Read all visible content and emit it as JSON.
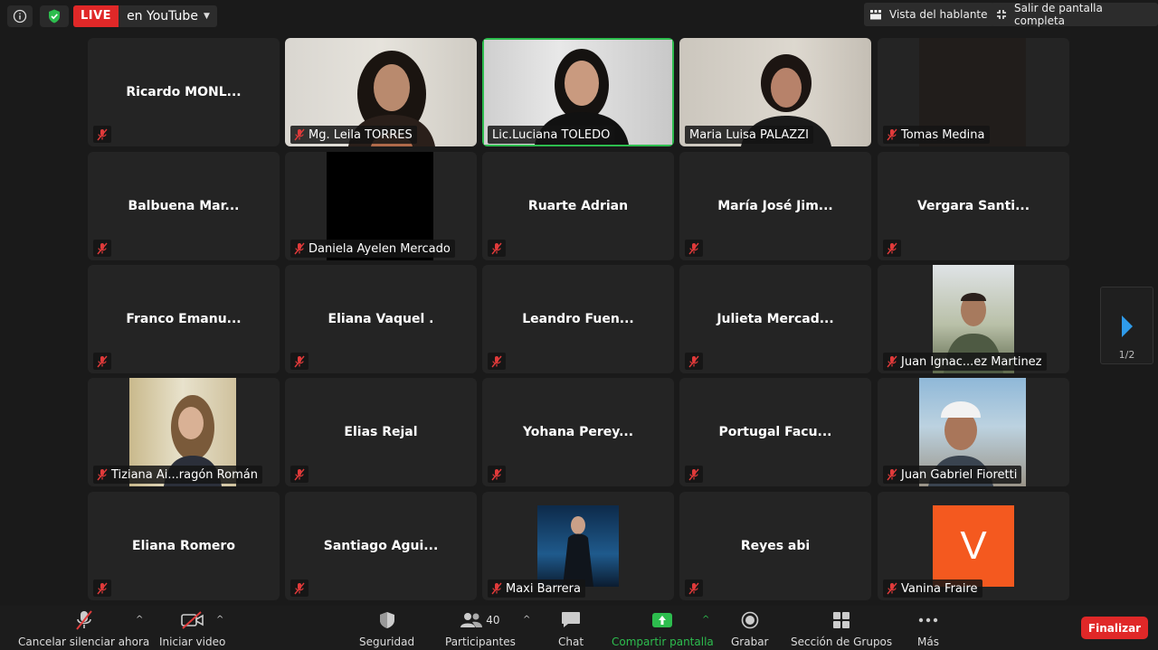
{
  "topbar": {
    "live_badge": "LIVE",
    "live_target": "en YouTube",
    "speaker_view": "Vista del hablante",
    "exit_fullscreen": "Salir de pantalla completa"
  },
  "participants": [
    {
      "name": "Ricardo MONL...",
      "video": false
    },
    {
      "name": "Mg. Leila TORRES",
      "video": true
    },
    {
      "name": "Lic.Luciana TOLEDO",
      "video": true,
      "active_speaker": true
    },
    {
      "name": "Maria Luisa PALAZZI",
      "video": true
    },
    {
      "name": "Tomas Medina",
      "video": true
    },
    {
      "name": "Balbuena Mar...",
      "video": false
    },
    {
      "name": "Daniela Ayelen Mercado",
      "video": true
    },
    {
      "name": "Ruarte Adrian",
      "video": false
    },
    {
      "name": "María José Jim...",
      "video": false
    },
    {
      "name": "Vergara Santi...",
      "video": false
    },
    {
      "name": "Franco Emanu...",
      "video": false
    },
    {
      "name": "Eliana Vaquel .",
      "video": false
    },
    {
      "name": "Leandro Fuen...",
      "video": false
    },
    {
      "name": "Julieta Mercad...",
      "video": false
    },
    {
      "name": "Juan Ignac...ez Martinez",
      "video": true
    },
    {
      "name": "Tiziana Ai...ragón Román",
      "video": true
    },
    {
      "name": "Elias Rejal",
      "video": false
    },
    {
      "name": "Yohana Perey...",
      "video": false
    },
    {
      "name": "Portugal Facu...",
      "video": false
    },
    {
      "name": "Juan Gabriel Fioretti",
      "video": true
    },
    {
      "name": "Eliana Romero",
      "video": false
    },
    {
      "name": "Santiago Agui...",
      "video": false
    },
    {
      "name": "Maxi Barrera",
      "video": true
    },
    {
      "name": "Reyes abi",
      "video": false
    },
    {
      "name": "Vanina Fraire",
      "video": true,
      "avatar_letter": "V"
    }
  ],
  "pager": {
    "page": "1/2"
  },
  "toolbar": {
    "unmute": "Cancelar silenciar ahora",
    "start_video": "Iniciar video",
    "security": "Seguridad",
    "participants": "Participantes",
    "participants_count": "40",
    "chat": "Chat",
    "share_screen": "Compartir pantalla",
    "record": "Grabar",
    "breakout": "Sección de Grupos",
    "more": "Más",
    "end": "Finalizar"
  },
  "colors": {
    "live": "#e02828",
    "active_border": "#2dbd4e",
    "end_button": "#e02828",
    "avatar_v": "#f4591f"
  }
}
